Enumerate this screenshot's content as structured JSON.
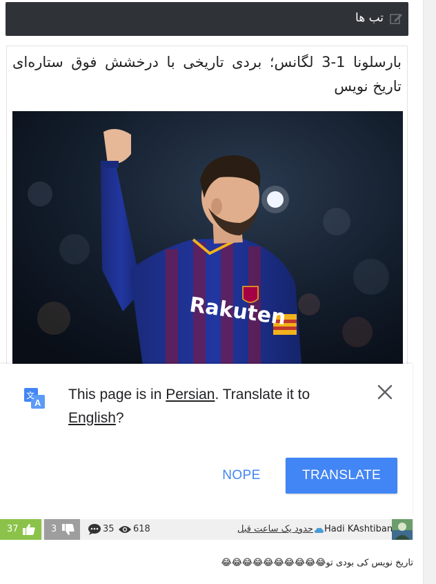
{
  "header": {
    "title": "تب ها"
  },
  "article": {
    "title": "بارسلونا 1-3 لگانس؛ بردی تاریخی با درخشش فوق ستاره‌ای تاریخ نویس"
  },
  "translate_popup": {
    "msg_prefix": "This page is in ",
    "source_language": "Persian",
    "msg_middle": ". Translate it to ",
    "target_language": "English",
    "msg_suffix": "?",
    "nope_label": "NOPE",
    "translate_label": "TRANSLATE",
    "accent_color": "#4285f4"
  },
  "comment": {
    "likes": "37",
    "dislikes": "3",
    "replies": "35",
    "views": "618",
    "time_ago": "حدود یک ساعت قبل",
    "author": "Hadi KAshtiban",
    "text": "تاریخ نویس کی بودی تو😂😂😂😂😂😂😂😂😂😂",
    "like_color": "#8bc34a",
    "dislike_color": "#9e9e9e"
  }
}
